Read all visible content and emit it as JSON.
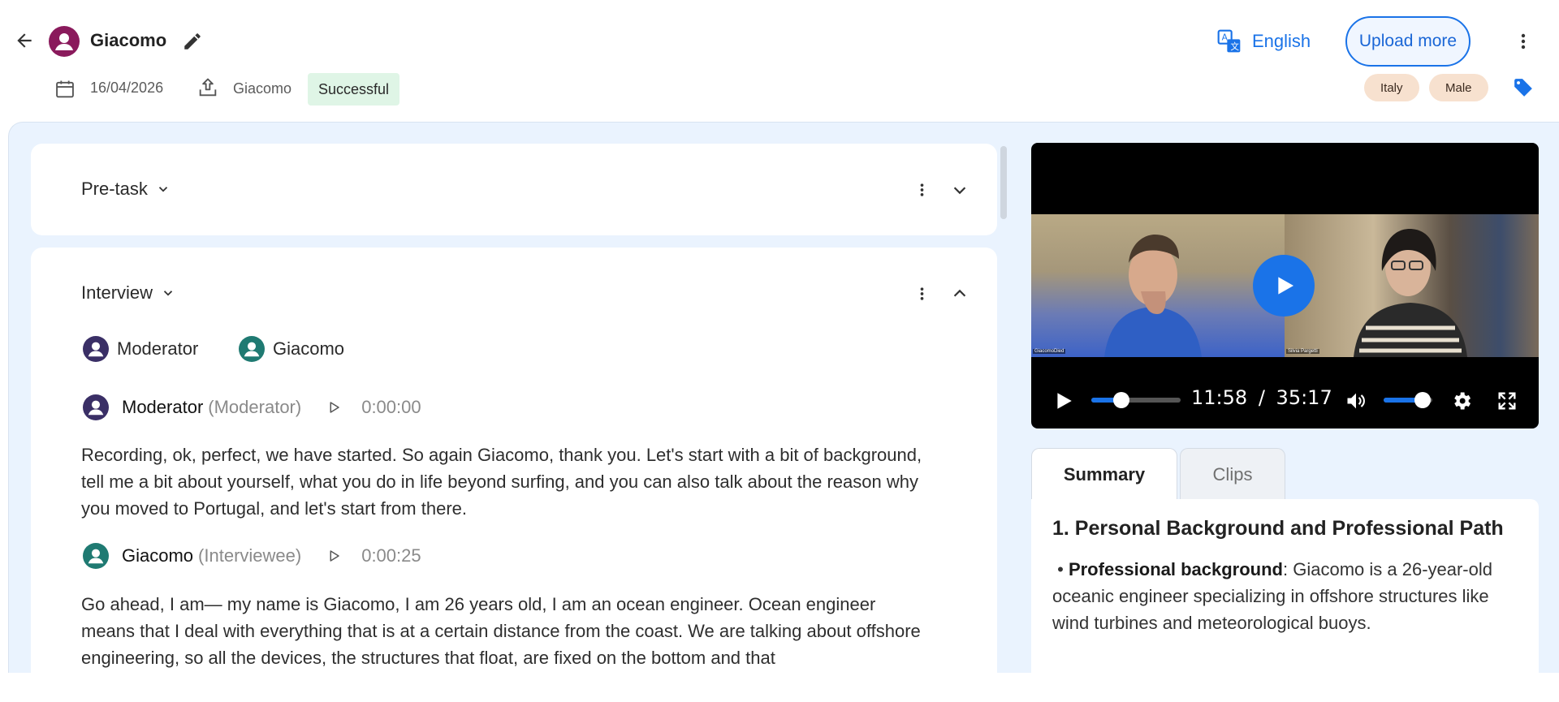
{
  "header": {
    "title": "Giacomo",
    "date": "16/04/2026",
    "uploader": "Giacomo",
    "status": "Successful",
    "language": "English",
    "upload_label": "Upload more",
    "tags": [
      "Italy",
      "Male"
    ]
  },
  "sections": {
    "pretask": {
      "title": "Pre-task"
    },
    "interview": {
      "title": "Interview"
    }
  },
  "speakers": [
    {
      "name": "Moderator"
    },
    {
      "name": "Giacomo"
    }
  ],
  "turns": [
    {
      "name": "Moderator",
      "role": "(Moderator)",
      "time": "0:00:00",
      "text": "Recording, ok, perfect, we have started. So again Giacomo, thank you. Let's start with a bit of background, tell me a bit about yourself, what you do in life beyond surfing, and you can also talk about the reason why you moved to Portugal, and let's start from there."
    },
    {
      "name": "Giacomo",
      "role": "(Interviewee)",
      "time": "0:00:25",
      "text": "Go ahead, I am— my name is Giacomo, I am 26 years old, I am an ocean engineer. Ocean engineer means that I deal with everything that is at a certain distance from the coast. We are talking about offshore engineering, so all the devices, the structures that float, are fixed on the bottom and that"
    }
  ],
  "video": {
    "current_time": "11:58",
    "separator": "/",
    "duration": "35:17",
    "progress": 0.34,
    "volume": 0.8,
    "left_label": "GiacomoDied",
    "right_label": "Silvia Pargetti"
  },
  "tabs": [
    {
      "label": "Summary",
      "active": true
    },
    {
      "label": "Clips",
      "active": false
    }
  ],
  "summary": {
    "heading": "1. Personal Background and Professional Path",
    "bullet_label": "Professional background",
    "bullet_text": ": Giacomo is a 26-year-old oceanic engineer specializing in offshore structures like wind turbines and meteorological buoys."
  },
  "colors": {
    "accent": "#1a73e8",
    "success_bg": "#dff5e6",
    "tag_bg": "#f7e1cf",
    "content_bg": "#eaf3fe"
  }
}
